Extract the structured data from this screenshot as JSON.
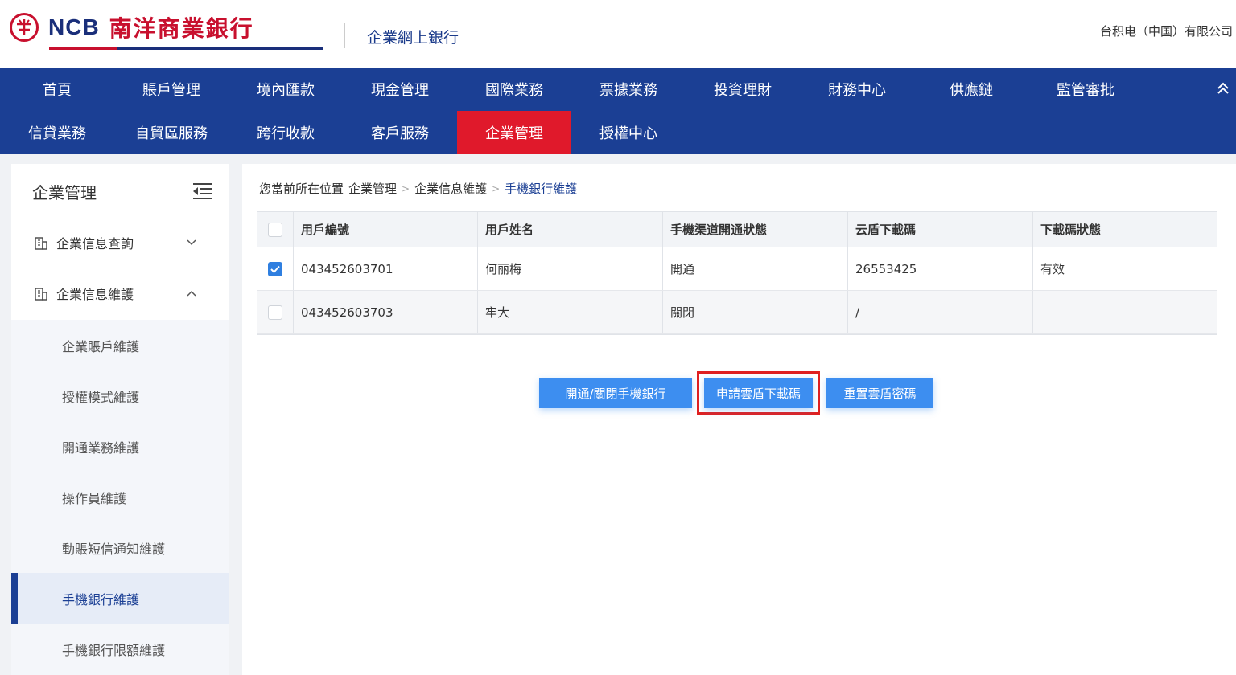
{
  "header": {
    "logo_emblem": "𠆢",
    "logo_ncb": "NCB",
    "logo_cn": "南洋商業銀行",
    "subtitle": "企業網上銀行",
    "company": "台积电（中国）有限公司"
  },
  "nav": {
    "row1": [
      "首頁",
      "賬戶管理",
      "境內匯款",
      "現金管理",
      "國際業務",
      "票據業務",
      "投資理財",
      "財務中心",
      "供應鏈",
      "監管審批"
    ],
    "row2": [
      "信貸業務",
      "自貿區服務",
      "跨行收款",
      "客戶服務",
      "企業管理",
      "授權中心"
    ],
    "active": "企業管理",
    "collapse_icon": "︽"
  },
  "sidebar": {
    "title": "企業管理",
    "groups": [
      {
        "label": "企業信息查詢",
        "chevron": "⌄"
      },
      {
        "label": "企業信息維護",
        "chevron": "⌃"
      }
    ],
    "sub_items": [
      "企業賬戶維護",
      "授權模式維護",
      "開通業務維護",
      "操作員維護",
      "動賬短信通知維護",
      "手機銀行維護",
      "手機銀行限額維護"
    ],
    "active_sub": "手機銀行維護"
  },
  "breadcrumb": {
    "prefix": "您當前所在位置",
    "items": [
      "企業管理",
      "企業信息維護",
      "手機銀行維護"
    ]
  },
  "table": {
    "headers": [
      "用戶編號",
      "用戶姓名",
      "手機渠道開通狀態",
      "云盾下載碼",
      "下載碼狀態"
    ],
    "rows": [
      {
        "checked": true,
        "cells": [
          "043452603701",
          "何丽梅",
          "開通",
          "26553425",
          "有效"
        ]
      },
      {
        "checked": false,
        "cells": [
          "043452603703",
          "牢大",
          "關閉",
          "/",
          ""
        ]
      }
    ]
  },
  "actions": {
    "toggle_mobile": "開通/關閉手機銀行",
    "apply_code": "申請雲盾下載碼",
    "reset_password": "重置雲盾密碼"
  },
  "colors": {
    "nav_bg": "#1b3f94",
    "nav_active": "#e0192b",
    "button": "#3d8ef0",
    "highlight_frame": "#e02020"
  }
}
